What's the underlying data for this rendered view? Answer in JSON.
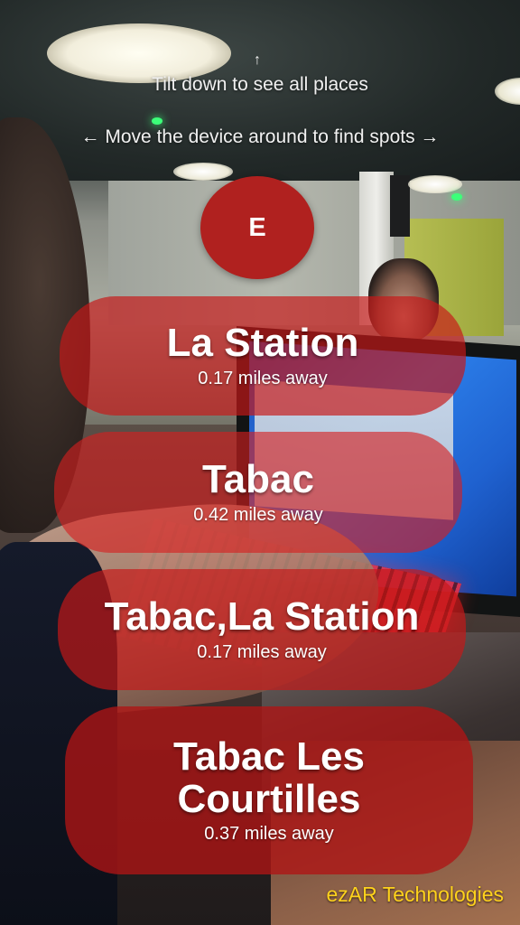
{
  "hints": {
    "tilt_arrow": "↑",
    "tilt": "Tilt down to see all places",
    "move": "← Move the device around to find spots →"
  },
  "compass": {
    "heading": "E",
    "color": "#b0211f"
  },
  "places": [
    {
      "name": "La Station",
      "distance": "0.17 miles away"
    },
    {
      "name": "Tabac",
      "distance": "0.42 miles away"
    },
    {
      "name": "Tabac,La Station",
      "distance": "0.17 miles away"
    },
    {
      "name": "Tabac Les Courtilles",
      "distance": "0.37 miles away"
    }
  ],
  "branding": {
    "watermark": "ezAR Technologies",
    "watermark_color": "#ffd21c"
  },
  "colors": {
    "card_fill": "#c71818"
  }
}
